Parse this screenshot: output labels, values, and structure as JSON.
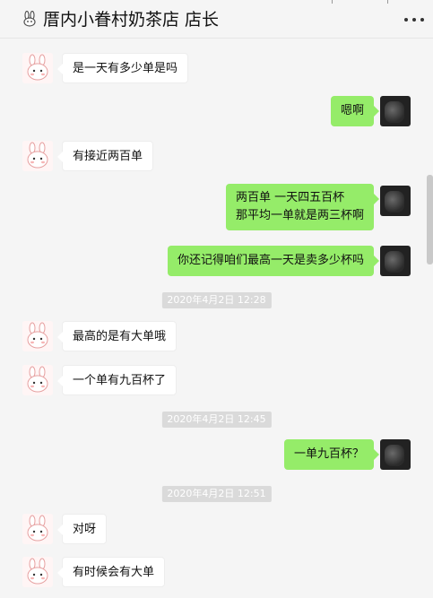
{
  "header": {
    "title": "厝内小眷村奶茶店 店长"
  },
  "messages": [
    {
      "text": "是一天有多少单是吗"
    },
    {
      "text": "嗯啊"
    },
    {
      "text": "有接近两百单"
    },
    {
      "line1": "两百单  一天四五百杯",
      "line2": "那平均一单就是两三杯啊"
    },
    {
      "text": "你还记得咱们最高一天是卖多少杯吗"
    },
    {
      "time": "2020年4月2日 12:28"
    },
    {
      "text": "最高的是有大单哦"
    },
    {
      "text": "一个单有九百杯了"
    },
    {
      "time": "2020年4月2日 12:45"
    },
    {
      "text": "一单九百杯？"
    },
    {
      "time": "2020年4月2日 12:51"
    },
    {
      "text": "对呀"
    },
    {
      "text": "有时候会有大单"
    }
  ],
  "icons": {
    "header": "rabbit-icon",
    "menu": "more-dots-icon",
    "contact_avatar": "cartoon-bunny-avatar",
    "self_avatar": "blurred-photo-avatar"
  },
  "colors": {
    "sent_bubble": "#95ec69",
    "received_bubble": "#ffffff",
    "background": "#f5f5f5"
  }
}
